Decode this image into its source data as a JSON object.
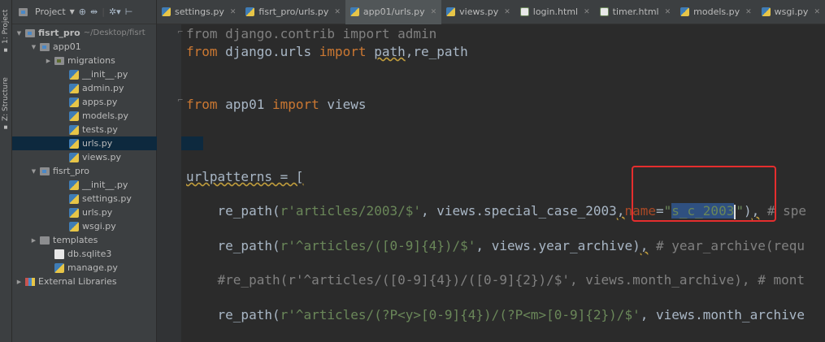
{
  "tool_strip": {
    "project_tab": "1: Project",
    "structure_tab": "Z: Structure"
  },
  "project_toolbar": {
    "view_label": "Project",
    "icons": [
      "globe-icon",
      "split-icon",
      "settings-icon",
      "collapse-icon"
    ]
  },
  "tree": [
    {
      "label": "fisrt_pro",
      "path": "~/Desktop/fisrt",
      "type": "dir-module",
      "depth": 0,
      "expanded": true
    },
    {
      "label": "app01",
      "type": "dir-module",
      "depth": 1,
      "expanded": true
    },
    {
      "label": "migrations",
      "type": "dir-migrations",
      "depth": 2,
      "expanded": false
    },
    {
      "label": "__init__.py",
      "type": "py",
      "depth": 3
    },
    {
      "label": "admin.py",
      "type": "py",
      "depth": 3
    },
    {
      "label": "apps.py",
      "type": "py",
      "depth": 3
    },
    {
      "label": "models.py",
      "type": "py",
      "depth": 3
    },
    {
      "label": "tests.py",
      "type": "py",
      "depth": 3
    },
    {
      "label": "urls.py",
      "type": "py",
      "depth": 3,
      "selected": true
    },
    {
      "label": "views.py",
      "type": "py",
      "depth": 3
    },
    {
      "label": "fisrt_pro",
      "type": "dir-module",
      "depth": 1,
      "expanded": true
    },
    {
      "label": "__init__.py",
      "type": "py",
      "depth": 3
    },
    {
      "label": "settings.py",
      "type": "py",
      "depth": 3
    },
    {
      "label": "urls.py",
      "type": "py",
      "depth": 3
    },
    {
      "label": "wsgi.py",
      "type": "py",
      "depth": 3
    },
    {
      "label": "templates",
      "type": "dir",
      "depth": 1,
      "expanded": false
    },
    {
      "label": "db.sqlite3",
      "type": "db",
      "depth": 2
    },
    {
      "label": "manage.py",
      "type": "py",
      "depth": 2
    },
    {
      "label": "External Libraries",
      "type": "lib",
      "depth": 0,
      "expanded": false
    }
  ],
  "tabs": [
    {
      "label": "settings.py",
      "icon": "py"
    },
    {
      "label": "fisrt_pro/urls.py",
      "icon": "py"
    },
    {
      "label": "app01/urls.py",
      "icon": "py",
      "active": true
    },
    {
      "label": "views.py",
      "icon": "py"
    },
    {
      "label": "login.html",
      "icon": "html"
    },
    {
      "label": "timer.html",
      "icon": "html"
    },
    {
      "label": "models.py",
      "icon": "py"
    },
    {
      "label": "wsgi.py",
      "icon": "py"
    }
  ],
  "code": [
    [
      {
        "t": "from django.contrib import admin",
        "c": "cmt"
      }
    ],
    [
      {
        "t": "from",
        "c": "kw"
      },
      {
        "t": " django.urls "
      },
      {
        "t": "import",
        "c": "kw"
      },
      {
        "t": " "
      },
      {
        "t": "path",
        "c": "wavy"
      },
      {
        "t": ",re_path"
      }
    ],
    [],
    [
      {
        "t": "from",
        "c": "kw"
      },
      {
        "t": " app01 "
      },
      {
        "t": "import",
        "c": "kw"
      },
      {
        "t": " views"
      }
    ],
    [],
    [],
    [
      {
        "t": "urlpatterns = [",
        "c": "wavy"
      }
    ],
    [
      {
        "t": "    re_path("
      },
      {
        "t": "r'articles/2003/$'",
        "c": "str"
      },
      {
        "t": ", views.special_case_2003"
      },
      {
        "t": ",",
        "c": "wavy"
      },
      {
        "t": "name",
        "c": "par"
      },
      {
        "t": "="
      },
      {
        "t": "\"",
        "c": "str"
      },
      {
        "t": "s_c_2003",
        "c": "hl"
      },
      {
        "t": "",
        "c": "cursor"
      },
      {
        "t": "\"",
        "c": "str"
      },
      {
        "t": ")"
      },
      {
        "t": ",",
        "c": "wavy"
      },
      {
        "t": " # spe",
        "c": "cmt"
      }
    ],
    [
      {
        "t": "    re_path("
      },
      {
        "t": "r'^articles/([0-9]{4})/$'",
        "c": "str"
      },
      {
        "t": ", views.year_archive)"
      },
      {
        "t": ",",
        "c": "wavy"
      },
      {
        "t": " # year_archive(requ",
        "c": "cmt"
      }
    ],
    [
      {
        "t": "    #re_path(r'^articles/([0-9]{4})/([0-9]{2})/$', views.month_archive), # mont",
        "c": "cmt"
      }
    ],
    [
      {
        "t": "    re_path("
      },
      {
        "t": "r'^articles/(?P<y>[0-9]{4})/(?P<m>[0-9]{2})/$'",
        "c": "str"
      },
      {
        "t": ", views.month_archive"
      }
    ]
  ],
  "colors": {
    "keyword": "#cc7832",
    "string": "#6a8759",
    "comment": "#808080",
    "param": "#aa4926",
    "annotation_box": "#e52e2e"
  }
}
